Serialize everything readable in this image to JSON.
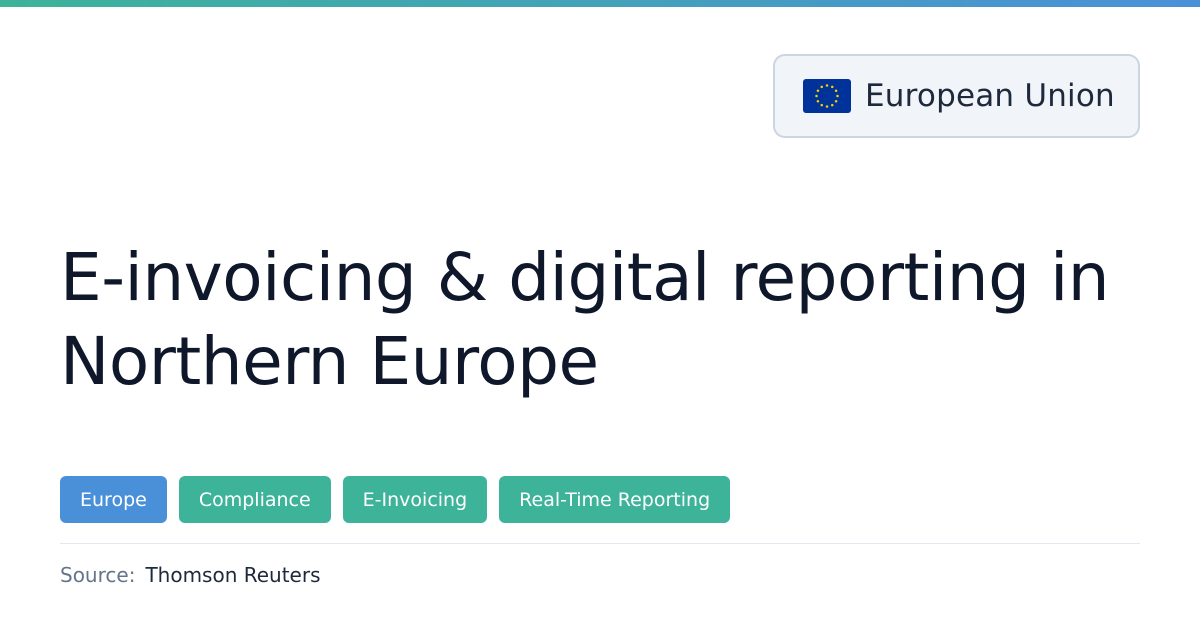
{
  "colors": {
    "accent_gradient_start": "#3db39a",
    "accent_gradient_end": "#4a90d9",
    "region_tag": "#4a90d9",
    "topic_tag": "#3db39a",
    "flag_blue": "#003399",
    "flag_star": "#ffcc00"
  },
  "region": {
    "flag_icon": "eu-flag-icon",
    "name": "European Union"
  },
  "title": {
    "line1": "E-invoicing & digital reporting in",
    "line2": "Northern Europe"
  },
  "tags": [
    {
      "label": "Europe",
      "color": "#4a90d9"
    },
    {
      "label": "Compliance",
      "color": "#3db39a"
    },
    {
      "label": "E-Invoicing",
      "color": "#3db39a"
    },
    {
      "label": "Real-Time Reporting",
      "color": "#3db39a"
    }
  ],
  "source": {
    "label": "Source:",
    "value": "Thomson Reuters"
  }
}
